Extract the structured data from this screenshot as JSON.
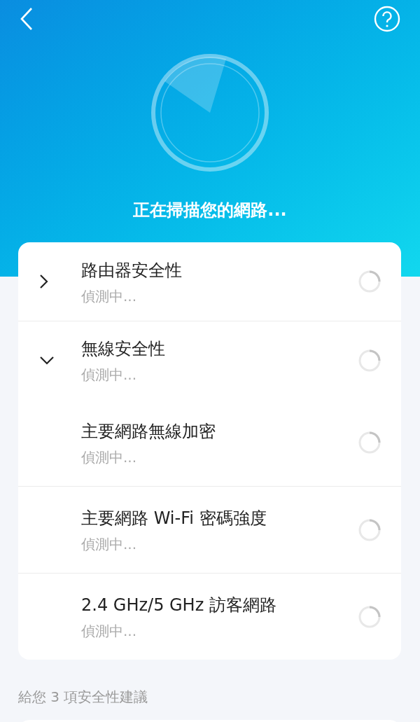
{
  "header": {
    "title": "正在掃描您的網路..."
  },
  "checks": [
    {
      "title": "路由器安全性",
      "status": "偵測中...",
      "expanded": false
    },
    {
      "title": "無線安全性",
      "status": "偵測中...",
      "expanded": true,
      "children": [
        {
          "title": "主要網路無線加密",
          "status": "偵測中..."
        },
        {
          "title": "主要網路 Wi-Fi 密碼強度",
          "status": "偵測中..."
        },
        {
          "title": "2.4 GHz/5 GHz 訪客網路",
          "status": "偵測中..."
        }
      ]
    }
  ],
  "suggestions_heading": "給您 3 項安全性建議"
}
